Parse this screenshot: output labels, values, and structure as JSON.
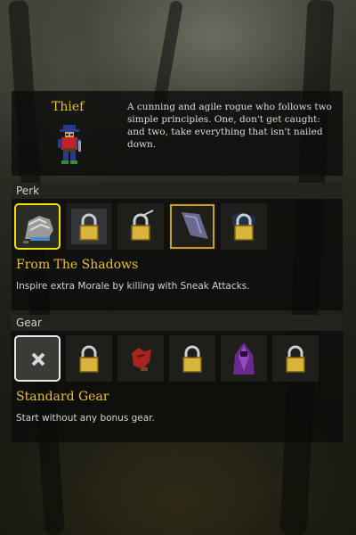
{
  "class_info": {
    "name": "Thief",
    "description": "A cunning and agile rogue who follows two simple principles. One, don't get caught: and two, take everything that isn't nailed down.",
    "sprite_icon": "thief-character-icon"
  },
  "perk": {
    "label": "Perk",
    "slots": [
      {
        "icon": "shadow-boot-icon",
        "locked": false,
        "selected": true
      },
      {
        "icon": "lock-icon",
        "locked": true,
        "selected": false
      },
      {
        "icon": "lock-icon",
        "locked": true,
        "selected": false
      },
      {
        "icon": "cloak-icon",
        "locked": false,
        "selected": false
      },
      {
        "icon": "lock-icon",
        "locked": true,
        "selected": false
      }
    ],
    "selected_title": "From The Shadows",
    "selected_desc": "Inspire extra Morale by killing with Sneak Attacks."
  },
  "gear": {
    "label": "Gear",
    "slots": [
      {
        "icon": "close-x-icon",
        "locked": false,
        "selected": true
      },
      {
        "icon": "lock-icon",
        "locked": true,
        "selected": false
      },
      {
        "icon": "red-bag-icon",
        "locked": false,
        "selected": false
      },
      {
        "icon": "lock-icon",
        "locked": true,
        "selected": false
      },
      {
        "icon": "purple-cloak-icon",
        "locked": false,
        "selected": false
      },
      {
        "icon": "lock-icon",
        "locked": true,
        "selected": false
      }
    ],
    "selected_title": "Standard Gear",
    "selected_desc": "Start without any bonus gear."
  },
  "colors": {
    "title_gold": "#e8c02a",
    "perk_highlight": "#f2e100",
    "gear_highlight": "#e8e8e8",
    "lock_gold": "#d9b43a"
  }
}
